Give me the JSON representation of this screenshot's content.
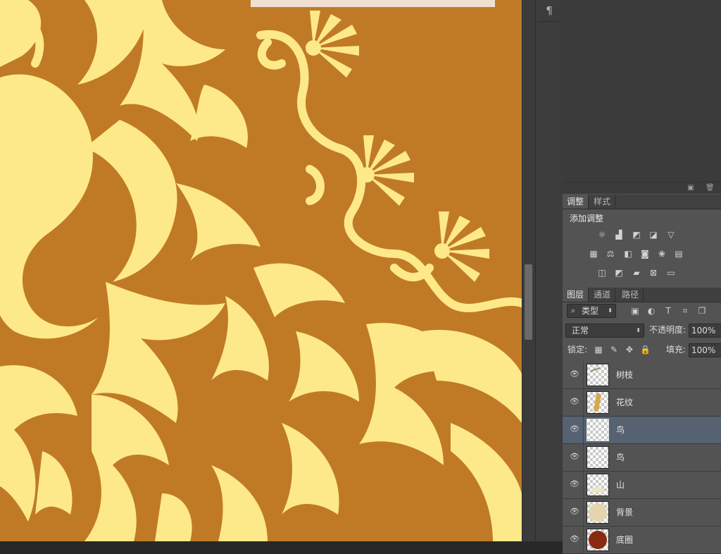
{
  "adjustments_panel": {
    "tabs": [
      "调整",
      "样式"
    ],
    "title": "添加调整",
    "icons": [
      [
        "brightness-contrast-icon",
        "levels-icon",
        "curves-icon",
        "exposure-icon",
        "vibrance-icon"
      ],
      [
        "hue-saturation-icon",
        "color-balance-icon",
        "black-white-icon",
        "photo-filter-icon",
        "channel-mixer-icon",
        "color-lookup-icon"
      ],
      [
        "invert-icon",
        "posterize-icon",
        "threshold-icon",
        "selective-color-icon",
        "gradient-map-icon"
      ]
    ]
  },
  "layers_panel": {
    "tabs": [
      "图层",
      "通道",
      "路径"
    ],
    "filter_label": "类型",
    "blend_mode": "正常",
    "opacity_label": "不透明度:",
    "opacity_value": "100%",
    "lock_label": "锁定:",
    "fill_label": "填充:",
    "fill_value": "100%",
    "layers": [
      {
        "name": "树枝",
        "selected": false
      },
      {
        "name": "花纹",
        "selected": false
      },
      {
        "name": "鸟",
        "selected": true
      },
      {
        "name": "鸟",
        "selected": false
      },
      {
        "name": "山",
        "selected": false
      },
      {
        "name": "背景",
        "selected": false
      },
      {
        "name": "底圈",
        "selected": false
      }
    ]
  },
  "colors": {
    "canvas_bg": "#c07a26",
    "ornament": "#fde98a",
    "selected_layer": "#566172",
    "panel_bg": "#535353"
  }
}
